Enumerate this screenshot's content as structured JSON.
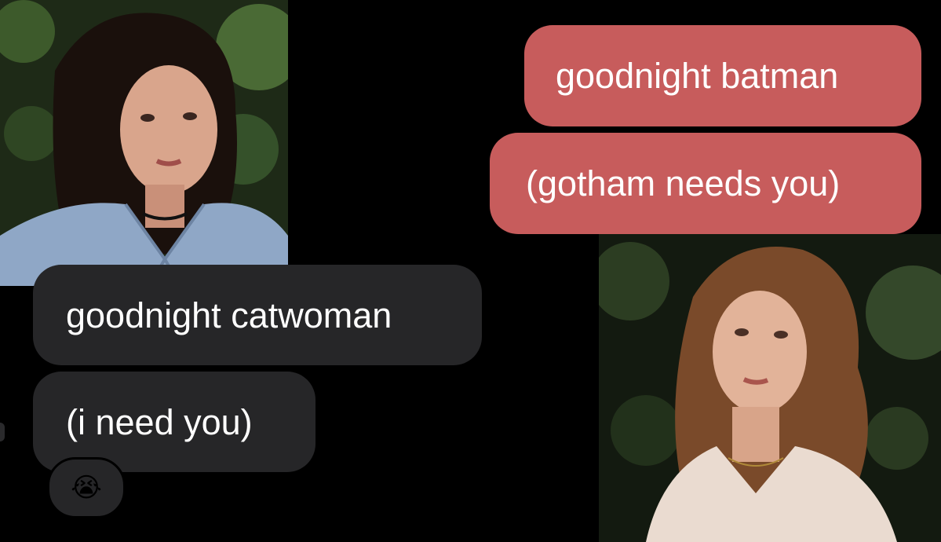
{
  "messages": {
    "sent": [
      {
        "text": "goodnight batman"
      },
      {
        "text": "(gotham needs you)"
      }
    ],
    "received": [
      {
        "text": "goodnight catwoman"
      },
      {
        "text": "(i need you)"
      }
    ],
    "reaction": {
      "glyph": "😭",
      "icon": "loudly-crying-face-icon"
    }
  },
  "colors": {
    "background": "#000000",
    "sent_bubble": "#c75c5c",
    "received_bubble": "#262628",
    "bubble_text": "#ffffff"
  }
}
